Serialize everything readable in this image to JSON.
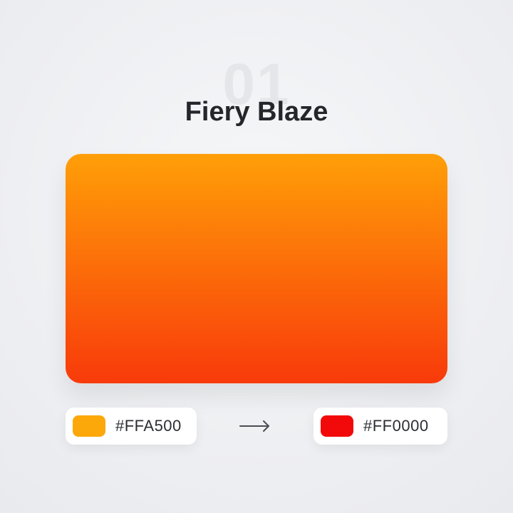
{
  "palette": {
    "number": "01",
    "title": "Fiery Blaze",
    "start_color": {
      "label": "#FFA500",
      "hex": "#FFA500"
    },
    "end_color": {
      "label": "#FF0000",
      "hex": "#FF0000"
    },
    "render_colors": {
      "gradient_top": "#FF9F08",
      "gradient_bottom": "#F83A0A",
      "start_swatch": "#FCA80A",
      "end_swatch": "#F20A0A"
    },
    "arrow_icon": "arrow-right-icon"
  }
}
